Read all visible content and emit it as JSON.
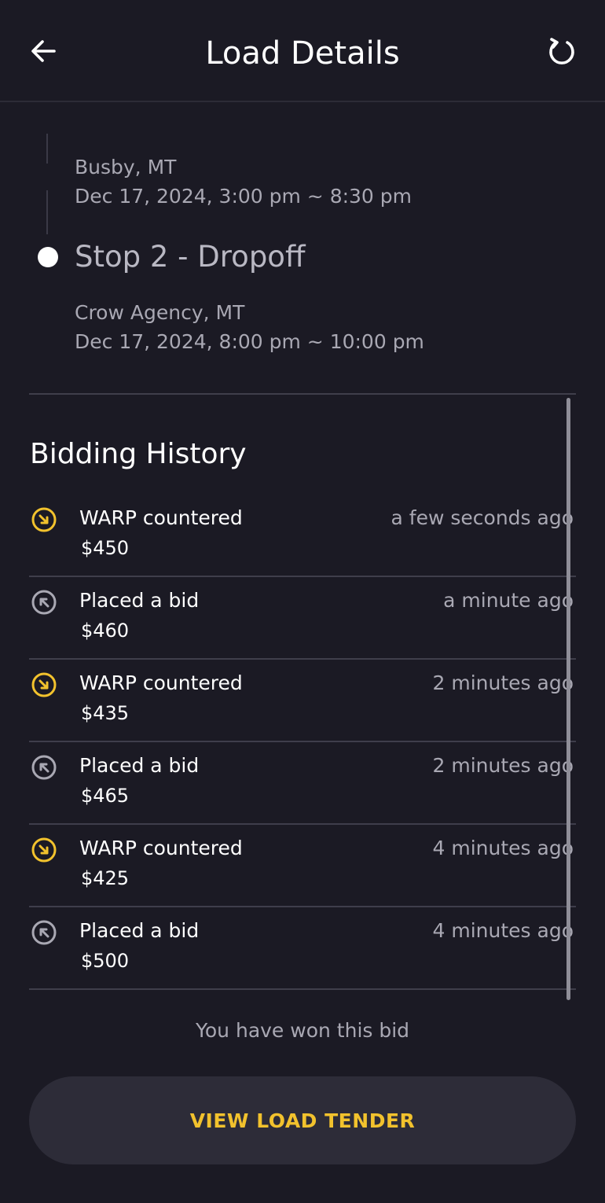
{
  "header": {
    "title": "Load Details",
    "back_icon": "arrow-left-icon",
    "refresh_icon": "refresh-icon"
  },
  "stops": [
    {
      "location": "Busby, MT",
      "window": "Dec 17, 2024, 3:00 pm ~ 8:30 pm"
    },
    {
      "title": "Stop 2 - Dropoff",
      "location": "Crow Agency, MT",
      "window": "Dec 17, 2024, 8:00 pm ~ 10:00 pm"
    }
  ],
  "bidding": {
    "title": "Bidding History",
    "entries": [
      {
        "label": "WARP countered",
        "amount": "$450",
        "time": "a few seconds ago",
        "kind": "counter"
      },
      {
        "label": "Placed a bid",
        "amount": "$460",
        "time": "a minute ago",
        "kind": "bid"
      },
      {
        "label": "WARP countered",
        "amount": "$435",
        "time": "2 minutes ago",
        "kind": "counter"
      },
      {
        "label": "Placed a bid",
        "amount": "$465",
        "time": "2 minutes ago",
        "kind": "bid"
      },
      {
        "label": "WARP countered",
        "amount": "$425",
        "time": "4 minutes ago",
        "kind": "counter"
      },
      {
        "label": "Placed a bid",
        "amount": "$500",
        "time": "4 minutes ago",
        "kind": "bid"
      }
    ],
    "status": "You have won this bid"
  },
  "actions": {
    "view_tender": "VIEW LOAD TENDER"
  },
  "colors": {
    "background": "#1b1a24",
    "accent": "#f2c22d",
    "muted": "#a9a8b3",
    "divider": "#3f3e4b"
  }
}
